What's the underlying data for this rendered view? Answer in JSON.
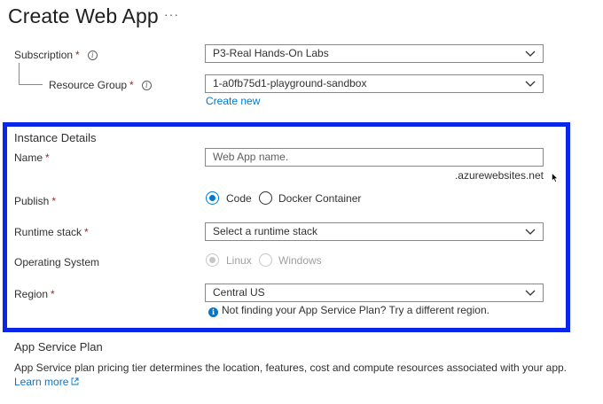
{
  "header": {
    "title": "Create Web App",
    "more": "···"
  },
  "subscription": {
    "label": "Subscription",
    "required": "*",
    "value": "P3-Real Hands-On Labs"
  },
  "resource_group": {
    "label": "Resource Group",
    "required": "*",
    "value": "1-a0fb75d1-playground-sandbox",
    "create_new": "Create new"
  },
  "instance": {
    "title": "Instance Details",
    "name": {
      "label": "Name",
      "required": "*",
      "placeholder": "Web App name.",
      "suffix": ".azurewebsites.net"
    },
    "publish": {
      "label": "Publish",
      "required": "*",
      "options": [
        "Code",
        "Docker Container"
      ],
      "selected": "Code"
    },
    "runtime": {
      "label": "Runtime stack",
      "required": "*",
      "placeholder": "Select a runtime stack"
    },
    "os": {
      "label": "Operating System",
      "options": [
        "Linux",
        "Windows"
      ],
      "selected": "Linux",
      "disabled": true
    },
    "region": {
      "label": "Region",
      "required": "*",
      "value": "Central US",
      "hint": "Not finding your App Service Plan? Try a different region."
    }
  },
  "app_service_plan": {
    "title": "App Service Plan",
    "description": "App Service plan pricing tier determines the location, features, cost and compute resources associated with your app.",
    "learn_more": "Learn more"
  },
  "colors": {
    "accent": "#0078d4",
    "highlight": "#0a26e8",
    "required": "#a4262c"
  }
}
